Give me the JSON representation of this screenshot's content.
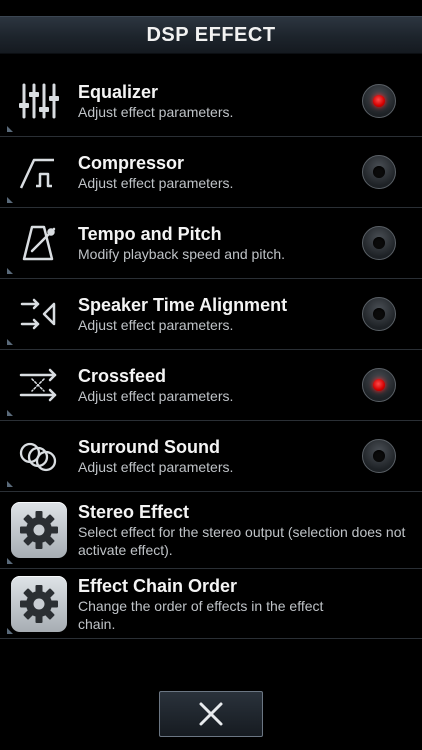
{
  "header": {
    "title": "DSP EFFECT"
  },
  "effects": [
    {
      "name": "Equalizer",
      "desc": "Adjust effect parameters.",
      "icon": "equalizer-sliders-icon",
      "enabled": true
    },
    {
      "name": "Compressor",
      "desc": "Adjust effect parameters.",
      "icon": "compressor-curve-icon",
      "enabled": false
    },
    {
      "name": "Tempo and Pitch",
      "desc": "Modify playback speed and pitch.",
      "icon": "metronome-icon",
      "enabled": false
    },
    {
      "name": "Speaker Time Alignment",
      "desc": "Adjust effect parameters.",
      "icon": "speaker-alignment-icon",
      "enabled": false
    },
    {
      "name": "Crossfeed",
      "desc": "Adjust effect parameters.",
      "icon": "crossfeed-arrows-icon",
      "enabled": true
    },
    {
      "name": "Surround Sound",
      "desc": "Adjust effect parameters.",
      "icon": "surround-circles-icon",
      "enabled": false
    }
  ],
  "settings": [
    {
      "name": "Stereo Effect",
      "desc": "Select effect for the stereo output (selection does not activate effect).",
      "icon": "gear-icon"
    },
    {
      "name": "Effect Chain Order",
      "desc": "Change the order of effects in the effect chain.",
      "icon": "gear-icon"
    }
  ],
  "footer": {
    "close_icon": "close-icon"
  },
  "colors": {
    "active_led": "#ff1a1a",
    "title_bar": "#1d242c",
    "background": "#000000"
  }
}
